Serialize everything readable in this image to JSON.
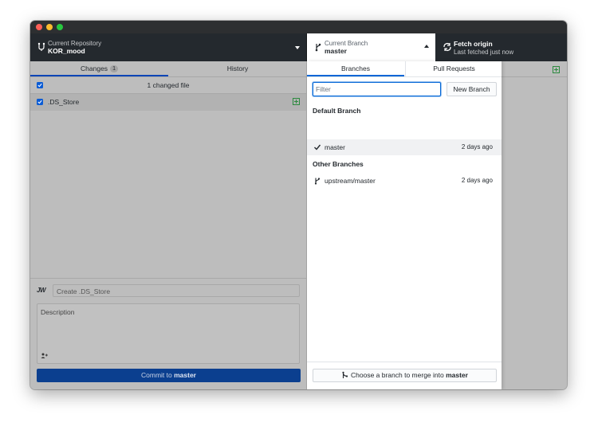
{
  "window": {
    "toolbar": {
      "repo": {
        "label": "Current Repository",
        "name": "KOR_mood"
      },
      "branch": {
        "label": "Current Branch",
        "name": "master"
      },
      "fetch": {
        "title": "Fetch origin",
        "subtitle": "Last fetched just now"
      }
    },
    "left": {
      "tabs": {
        "changes": "Changes",
        "changes_count": "1",
        "history": "History"
      },
      "changed_files_label": "1 changed file",
      "files": [
        {
          "name": ".DS_Store",
          "status": "added",
          "checked": true
        }
      ],
      "commit": {
        "avatar": "JW",
        "summary_placeholder": "Create .DS_Store",
        "description_placeholder": "Description",
        "button_prefix": "Commit to",
        "button_branch": "master"
      }
    },
    "dropdown": {
      "tabs": {
        "branches": "Branches",
        "pull_requests": "Pull Requests"
      },
      "filter_placeholder": "Filter",
      "new_branch_label": "New Branch",
      "default_group": "Default Branch",
      "default_branches": [
        {
          "name": "master",
          "time": "2 days ago",
          "current": true
        }
      ],
      "other_group": "Other Branches",
      "other_branches": [
        {
          "name": "upstream/master",
          "time": "2 days ago"
        }
      ],
      "merge_prefix": "Choose a branch to merge into",
      "merge_branch": "master"
    },
    "icons": {
      "repo": "repo-icon",
      "branch": "git-branch-icon",
      "fetch": "sync-icon",
      "check": "check-icon",
      "merge": "git-merge-icon",
      "add_file": "diff-added-icon"
    },
    "colors": {
      "accent": "#0366d6",
      "commit_button": "#0b3f8f",
      "added": "#2b8a3e"
    }
  }
}
